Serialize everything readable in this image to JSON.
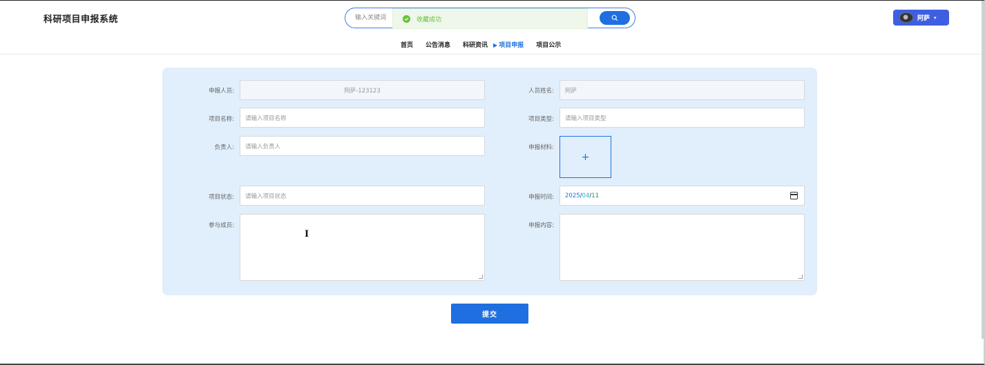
{
  "header": {
    "app_title": "科研项目申报系统",
    "search_placeholder": "输入关键词",
    "search_icon": "search-icon",
    "user_name": "阿萨",
    "user_caret": "▾"
  },
  "toast": {
    "message": "收藏成功",
    "icon": "check-circle-icon",
    "color": "#67c23a"
  },
  "nav": {
    "items": [
      {
        "label": "首页"
      },
      {
        "label": "公告消息"
      },
      {
        "label": "科研资讯"
      },
      {
        "label": "项目申报",
        "active": true
      },
      {
        "label": "项目公示"
      }
    ],
    "active_marker": "▶"
  },
  "form": {
    "applicant": {
      "label": "申报人员:",
      "value": "阿萨-123123"
    },
    "person_name": {
      "label": "人员姓名:",
      "value": "阿萨"
    },
    "project_name": {
      "label": "项目名称:",
      "placeholder": "请输入项目名称"
    },
    "project_type": {
      "label": "项目类型:",
      "placeholder": "请输入项目类型"
    },
    "leader": {
      "label": "负责人:",
      "placeholder": "请输入负责人"
    },
    "materials": {
      "label": "申报材料:",
      "upload_symbol": "+"
    },
    "project_status": {
      "label": "项目状态:",
      "placeholder": "请输入项目状态"
    },
    "apply_time": {
      "label": "申报时间:",
      "year": "2025",
      "month": "04",
      "day": "11",
      "sep": "/"
    },
    "members": {
      "label": "参与成员:"
    },
    "content": {
      "label": "申报内容:"
    }
  },
  "submit_label": "提交",
  "colors": {
    "primary": "#1f6fe0",
    "panel": "#e1eefb",
    "success": "#67c23a"
  }
}
